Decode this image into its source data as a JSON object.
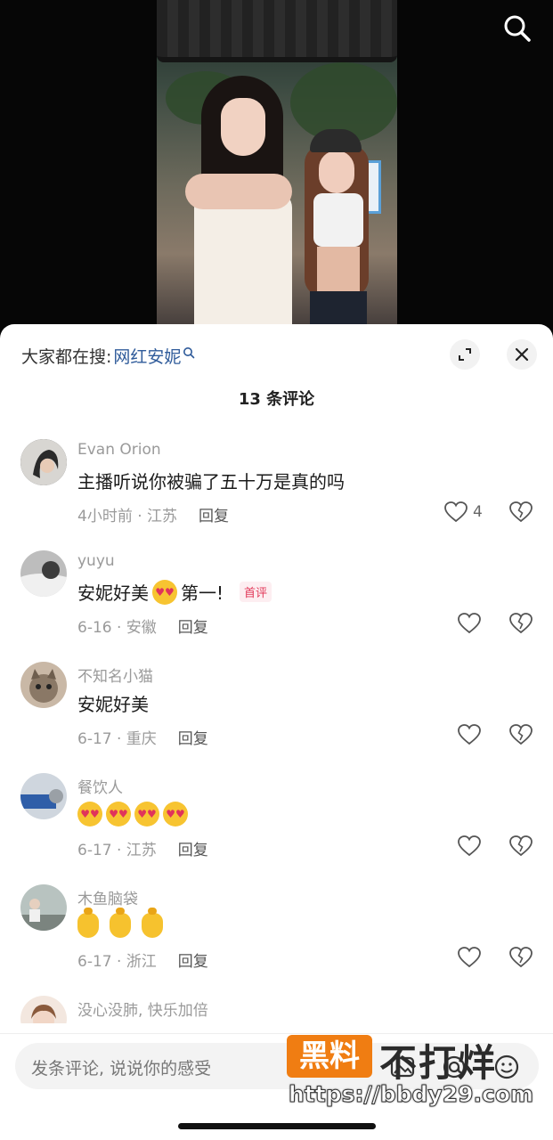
{
  "video": {
    "search_icon": "search-icon"
  },
  "sheet": {
    "hot_search_prefix": "大家都在搜:",
    "hot_search_keyword": "网红安妮",
    "comment_count": "13 条评论"
  },
  "comments": [
    {
      "user": "Evan Orion",
      "text": "主播听说你被骗了五十万是真的吗",
      "meta": "4小时前 · 江苏",
      "reply": "回复",
      "likes": "4",
      "avatar_color": "#3a3a3a"
    },
    {
      "user": "yuyu",
      "text": "安妮好美",
      "text_after": "第一!",
      "badge": "首评",
      "meta": "6-16 · 安徽",
      "reply": "回复",
      "likes": "",
      "avatar_color": "#555555"
    },
    {
      "user": "不知名小猫",
      "text": "安妮好美",
      "meta": "6-17 · 重庆",
      "reply": "回复",
      "likes": "",
      "avatar_color": "#8a7866"
    },
    {
      "user": "餐饮人",
      "text": "",
      "meta": "6-17 · 江苏",
      "reply": "回复",
      "likes": "",
      "avatar_color": "#5d6b7c"
    },
    {
      "user": "木鱼脑袋",
      "text": "",
      "meta": "6-17 · 浙江",
      "reply": "回复",
      "likes": "",
      "avatar_color": "#9aa3a0"
    },
    {
      "user": "没心没肺, 快乐加倍",
      "text": "",
      "meta": "",
      "reply": "",
      "likes": "",
      "avatar_color": "#e8d6cc"
    }
  ],
  "input": {
    "placeholder": "发条评论, 说说你的感受"
  },
  "watermark": {
    "tag": "黑料",
    "title": "不打烊",
    "url": "https://bbdy29.com"
  },
  "colors": {
    "keyword": "#2f5b9a",
    "badge": "#e23a5a",
    "watermark_tag": "#f07d12"
  }
}
